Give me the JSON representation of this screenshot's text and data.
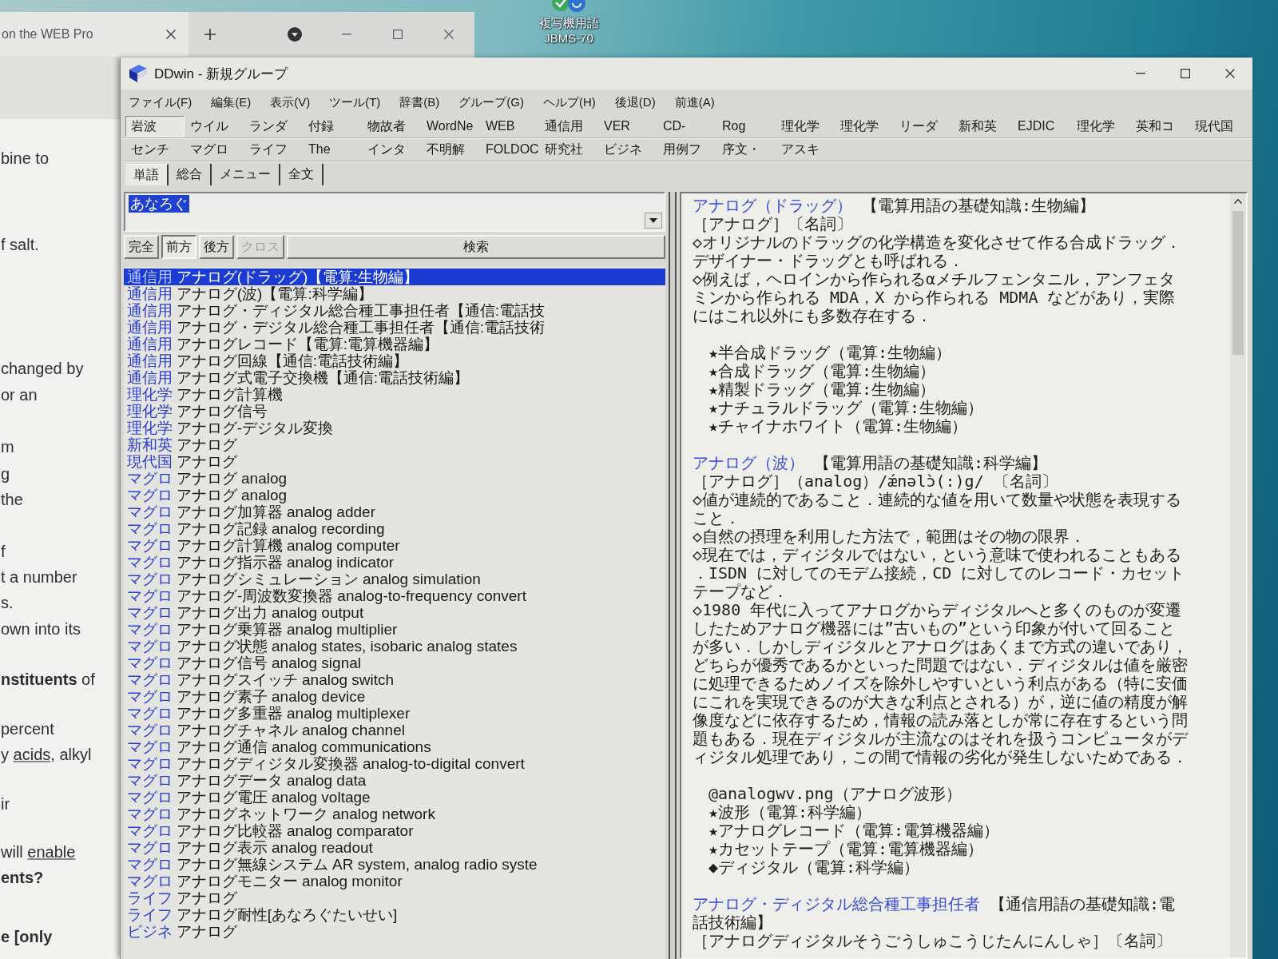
{
  "desktop_icon": {
    "label_lines": [
      "複写機用語",
      "JBMS-70"
    ]
  },
  "browser": {
    "tab_title": "on the WEB Pro",
    "page_lines": [
      {
        "parts": [
          {
            "kind": "plain",
            "text": "bine to"
          }
        ]
      },
      {
        "parts": [
          {
            "kind": "plain",
            "text": "f salt."
          }
        ]
      },
      {
        "parts": [
          {
            "kind": "plain",
            "text": "changed by"
          }
        ]
      },
      {
        "parts": [
          {
            "kind": "plain",
            "text": "or an"
          }
        ]
      },
      {
        "parts": [
          {
            "kind": "plain",
            "text": "m"
          }
        ]
      },
      {
        "parts": [
          {
            "kind": "plain",
            "text": "g"
          }
        ]
      },
      {
        "parts": [
          {
            "kind": "plain",
            "text": "the"
          }
        ]
      },
      {
        "parts": [
          {
            "kind": "plain",
            "text": "f"
          }
        ]
      },
      {
        "parts": [
          {
            "kind": "plain",
            "text": "t a number"
          }
        ]
      },
      {
        "parts": [
          {
            "kind": "plain",
            "text": "s."
          }
        ]
      },
      {
        "parts": [
          {
            "kind": "plain",
            "text": "own into its"
          }
        ]
      },
      {
        "parts": [
          {
            "kind": "bold",
            "text": "nstituents"
          },
          {
            "kind": "plain",
            "text": " of"
          }
        ]
      },
      {
        "parts": [
          {
            "kind": "plain",
            "text": "percent"
          }
        ]
      },
      {
        "parts": [
          {
            "kind": "plain",
            "text": "y "
          },
          {
            "kind": "link",
            "text": "acids"
          },
          {
            "kind": "plain",
            "text": ", alkyl"
          }
        ]
      },
      {
        "parts": [
          {
            "kind": "plain",
            "text": "ir"
          }
        ]
      },
      {
        "parts": [
          {
            "kind": "plain",
            "text": "will "
          },
          {
            "kind": "link",
            "text": "enable"
          }
        ]
      },
      {
        "parts": [
          {
            "kind": "bold",
            "text": "ents?"
          }
        ]
      },
      {
        "parts": [
          {
            "kind": "bold",
            "text": "e [only"
          }
        ]
      }
    ]
  },
  "window": {
    "title": "DDwin - 新規グループ"
  },
  "menu": [
    "ファイル(F)",
    "編集(E)",
    "表示(V)",
    "ツール(T)",
    "辞書(B)",
    "グループ(G)",
    "ヘルプ(H)",
    "後退(D)",
    "前進(A)"
  ],
  "dictionary_toolbar": {
    "rows": [
      [
        {
          "label": "岩波",
          "selected": true
        },
        {
          "label": "ウイル",
          "selected": false
        },
        {
          "label": "ランダ",
          "selected": false
        },
        {
          "label": "付録",
          "selected": false
        },
        {
          "label": "物故者",
          "selected": false
        },
        {
          "label": "WordNe",
          "selected": false
        },
        {
          "label": "WEB",
          "selected": false
        },
        {
          "label": "通信用",
          "selected": false
        },
        {
          "label": "VER",
          "selected": false
        },
        {
          "label": "CD-",
          "selected": false
        },
        {
          "label": "Rog",
          "selected": false
        },
        {
          "label": "理化学",
          "selected": false
        },
        {
          "label": "理化学",
          "selected": false
        },
        {
          "label": "リーダ",
          "selected": false
        },
        {
          "label": "新和英",
          "selected": false
        },
        {
          "label": "EJDIC",
          "selected": false
        },
        {
          "label": "理化学",
          "selected": false
        },
        {
          "label": "英和コ",
          "selected": false
        },
        {
          "label": "現代国",
          "selected": false
        }
      ],
      [
        {
          "label": "センチ",
          "selected": false
        },
        {
          "label": "マグロ",
          "selected": false
        },
        {
          "label": "ライフ",
          "selected": false
        },
        {
          "label": "The",
          "selected": false
        },
        {
          "label": "インタ",
          "selected": false
        },
        {
          "label": "不明解",
          "selected": false
        },
        {
          "label": "FOLDOC",
          "selected": false
        },
        {
          "label": "研究社",
          "selected": false
        },
        {
          "label": "ビジネ",
          "selected": false
        },
        {
          "label": "用例フ",
          "selected": false
        },
        {
          "label": "序文・",
          "selected": false
        },
        {
          "label": "アスキ",
          "selected": false
        }
      ]
    ]
  },
  "tabs": [
    {
      "label": "単語",
      "selected": true
    },
    {
      "label": "総合",
      "selected": false
    },
    {
      "label": "メニュー",
      "selected": false
    },
    {
      "label": "全文",
      "selected": false
    }
  ],
  "search": {
    "value": "あなろぐ",
    "text_selected": true
  },
  "match_buttons": [
    {
      "label": "完全",
      "pressed": false,
      "disabled": false
    },
    {
      "label": "前方",
      "pressed": true,
      "disabled": false
    },
    {
      "label": "後方",
      "pressed": false,
      "disabled": false
    },
    {
      "label": "クロス",
      "pressed": false,
      "disabled": true
    }
  ],
  "search_button": "検索",
  "results": [
    {
      "dictionary": "通信用",
      "entry": "アナログ(ドラッグ)【電算:生物編】",
      "selected": true
    },
    {
      "dictionary": "通信用",
      "entry": "アナログ(波)【電算:科学編】",
      "selected": false
    },
    {
      "dictionary": "通信用",
      "entry": "アナログ・ディジタル総合種工事担任者【通信:電話技",
      "selected": false
    },
    {
      "dictionary": "通信用",
      "entry": "アナログ・デジタル総合種工事担任者【通信:電話技術",
      "selected": false
    },
    {
      "dictionary": "通信用",
      "entry": "アナログレコード【電算:電算機器編】",
      "selected": false
    },
    {
      "dictionary": "通信用",
      "entry": "アナログ回線【通信:電話技術編】",
      "selected": false
    },
    {
      "dictionary": "通信用",
      "entry": "アナログ式電子交換機【通信:電話技術編】",
      "selected": false
    },
    {
      "dictionary": "理化学",
      "entry": "アナログ計算機",
      "selected": false
    },
    {
      "dictionary": "理化学",
      "entry": "アナログ信号",
      "selected": false
    },
    {
      "dictionary": "理化学",
      "entry": "アナログ-デジタル変換",
      "selected": false
    },
    {
      "dictionary": "新和英",
      "entry": "アナログ",
      "selected": false
    },
    {
      "dictionary": "現代国",
      "entry": "アナログ",
      "selected": false
    },
    {
      "dictionary": "マグロ",
      "entry": "アナログ analog",
      "selected": false
    },
    {
      "dictionary": "マグロ",
      "entry": "アナログ analog",
      "selected": false
    },
    {
      "dictionary": "マグロ",
      "entry": "アナログ加算器 analog adder",
      "selected": false
    },
    {
      "dictionary": "マグロ",
      "entry": "アナログ記録 analog recording",
      "selected": false
    },
    {
      "dictionary": "マグロ",
      "entry": "アナログ計算機 analog computer",
      "selected": false
    },
    {
      "dictionary": "マグロ",
      "entry": "アナログ指示器 analog indicator",
      "selected": false
    },
    {
      "dictionary": "マグロ",
      "entry": "アナログシミュレーション analog simulation",
      "selected": false
    },
    {
      "dictionary": "マグロ",
      "entry": "アナログ-周波数変換器 analog-to-frequency convert",
      "selected": false
    },
    {
      "dictionary": "マグロ",
      "entry": "アナログ出力 analog output",
      "selected": false
    },
    {
      "dictionary": "マグロ",
      "entry": "アナログ乗算器 analog multiplier",
      "selected": false
    },
    {
      "dictionary": "マグロ",
      "entry": "アナログ状態 analog states, isobaric analog states",
      "selected": false
    },
    {
      "dictionary": "マグロ",
      "entry": "アナログ信号 analog signal",
      "selected": false
    },
    {
      "dictionary": "マグロ",
      "entry": "アナログスイッチ analog switch",
      "selected": false
    },
    {
      "dictionary": "マグロ",
      "entry": "アナログ素子 analog device",
      "selected": false
    },
    {
      "dictionary": "マグロ",
      "entry": "アナログ多重器 analog multiplexer",
      "selected": false
    },
    {
      "dictionary": "マグロ",
      "entry": "アナログチャネル analog channel",
      "selected": false
    },
    {
      "dictionary": "マグロ",
      "entry": "アナログ通信 analog communications",
      "selected": false
    },
    {
      "dictionary": "マグロ",
      "entry": "アナログディジタル変換器 analog-to-digital convert",
      "selected": false
    },
    {
      "dictionary": "マグロ",
      "entry": "アナログデータ analog data",
      "selected": false
    },
    {
      "dictionary": "マグロ",
      "entry": "アナログ電圧 analog voltage",
      "selected": false
    },
    {
      "dictionary": "マグロ",
      "entry": "アナログネットワーク analog network",
      "selected": false
    },
    {
      "dictionary": "マグロ",
      "entry": "アナログ比較器 analog comparator",
      "selected": false
    },
    {
      "dictionary": "マグロ",
      "entry": "アナログ表示 analog readout",
      "selected": false
    },
    {
      "dictionary": "マグロ",
      "entry": "アナログ無線システム AR system, analog radio syste",
      "selected": false
    },
    {
      "dictionary": "マグロ",
      "entry": "アナログモニター analog monitor",
      "selected": false
    },
    {
      "dictionary": "ライフ",
      "entry": "アナログ",
      "selected": false
    },
    {
      "dictionary": "ライフ",
      "entry": "アナログ耐性[あなろぐたいせい]",
      "selected": false
    },
    {
      "dictionary": "ビジネ",
      "entry": "アナログ",
      "selected": false
    }
  ],
  "entries": [
    {
      "heading": "アナログ（ドラッグ）",
      "source": "【電算用語の基礎知識:生物編】",
      "blocks": [
        {
          "kind": "text",
          "text": "［アナログ］〔名詞〕"
        },
        {
          "kind": "text",
          "text": "◇オリジナルのドラッグの化学構造を変化させて作る合成ドラッグ．デザイナー・ドラッグとも呼ばれる．"
        },
        {
          "kind": "text",
          "text": "◇例えば，ヘロインから作られるαメチルフェンタニル，アンフェタミンから作られる MDA，X から作られる MDMA などがあり，実際にはこれ以外にも多数存在する．"
        },
        {
          "kind": "refs",
          "items": [
            "★半合成ドラッグ（電算:生物編）",
            "★合成ドラッグ（電算:生物編）",
            "★精製ドラッグ（電算:生物編）",
            "★ナチュラルドラッグ（電算:生物編）",
            "★チャイナホワイト（電算:生物編）"
          ]
        }
      ]
    },
    {
      "heading": "アナログ（波）",
      "source": "【電算用語の基礎知識:科学編】",
      "blocks": [
        {
          "kind": "text",
          "text": "［アナログ］（analog）/ǽnəlɔ̀(:)g/ 〔名詞〕"
        },
        {
          "kind": "text",
          "text": "◇値が連続的であること．連続的な値を用いて数量や状態を表現すること．"
        },
        {
          "kind": "text",
          "text": "◇自然の摂理を利用した方法で，範囲はその物の限界．"
        },
        {
          "kind": "text",
          "text": "◇現在では，ディジタルではない，という意味で使われることもある．ISDN に対してのモデム接続，CD に対してのレコード・カセットテープなど．"
        },
        {
          "kind": "text",
          "text": "◇1980 年代に入ってアナログからディジタルへと多くのものが変遷したためアナログ機器には”古いもの”という印象が付いて回ることが多い．しかしディジタルとアナログはあくまで方式の違いであり，どちらが優秀であるかといった問題ではない．ディジタルは値を厳密に処理できるためノイズを除外しやすいという利点がある（特に安価にこれを実現できるのが大きな利点とされる）が，逆に値の精度が解像度などに依存するため，情報の読み落としが常に存在するという問題もある．現在ディジタルが主流なのはそれを扱うコンピュータがディジタル処理であり，この間で情報の劣化が発生しないためである．"
        },
        {
          "kind": "refs",
          "items": [
            "@analogwv.png（アナログ波形）",
            "★波形（電算:科学編）",
            "★アナログレコード（電算:電算機器編）",
            "★カセットテープ（電算:電算機器編）",
            "◆ディジタル（電算:科学編）"
          ]
        }
      ]
    },
    {
      "heading": "アナログ・ディジタル総合種工事担任者",
      "source": "【通信用語の基礎知識:電話技術編】",
      "blocks": [
        {
          "kind": "text",
          "text": "［アナログディジタルそうごうしゅこうじたんにんしゃ］〔名詞〕"
        }
      ]
    }
  ]
}
